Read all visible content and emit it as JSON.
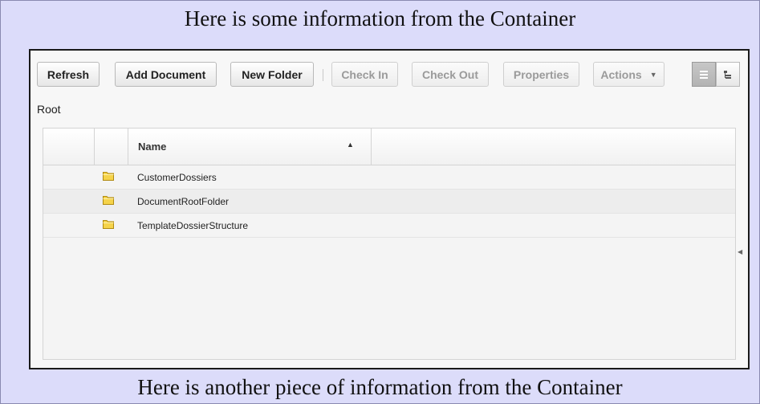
{
  "container": {
    "top_text": "Here is some information from the Container",
    "bottom_text": "Here is another piece of information from the Container"
  },
  "toolbar": {
    "refresh": "Refresh",
    "add_document": "Add Document",
    "new_folder": "New Folder",
    "check_in": "Check In",
    "check_out": "Check Out",
    "properties": "Properties",
    "actions": "Actions",
    "view_details": "list-view-icon",
    "view_tree": "tree-view-icon"
  },
  "breadcrumb": "Root",
  "grid": {
    "column_name": "Name",
    "sort": "ascending",
    "rows": [
      {
        "name": "CustomerDossiers",
        "icon": "folder-icon"
      },
      {
        "name": "DocumentRootFolder",
        "icon": "folder-icon"
      },
      {
        "name": "TemplateDossierStructure",
        "icon": "folder-icon"
      }
    ]
  },
  "colors": {
    "container_bg": "#dcdcfa",
    "folder": "#f5d34a"
  }
}
